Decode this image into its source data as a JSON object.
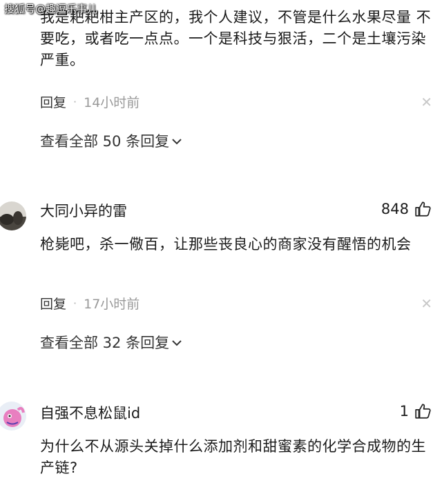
{
  "watermark": "搜狐号@趣逗乐事儿",
  "comments": [
    {
      "text": "我是耙耙柑主产区的，我个人建议，不管是什么水果尽量 不要吃，或者吃一点点。一个是科技与狠活，二个是土壤污染严重。",
      "reply_label": "回复",
      "time": "14小时前",
      "view_all": "查看全部 50 条回复"
    },
    {
      "username": "大同小异的雷",
      "likes": "848",
      "text": "枪毙吧，杀一儆百，让那些丧良心的商家没有醒悟的机会",
      "reply_label": "回复",
      "time": "17小时前",
      "view_all": "查看全部 32 条回复"
    },
    {
      "username": "自强不息松鼠id",
      "likes": "1",
      "text": "为什么不从源头关掉什么添加剂和甜蜜素的化学合成物的生产链?"
    }
  ],
  "icons": {
    "like": "thumbs-up-icon",
    "close": "close-icon",
    "chevron": "chevron-down-icon"
  }
}
